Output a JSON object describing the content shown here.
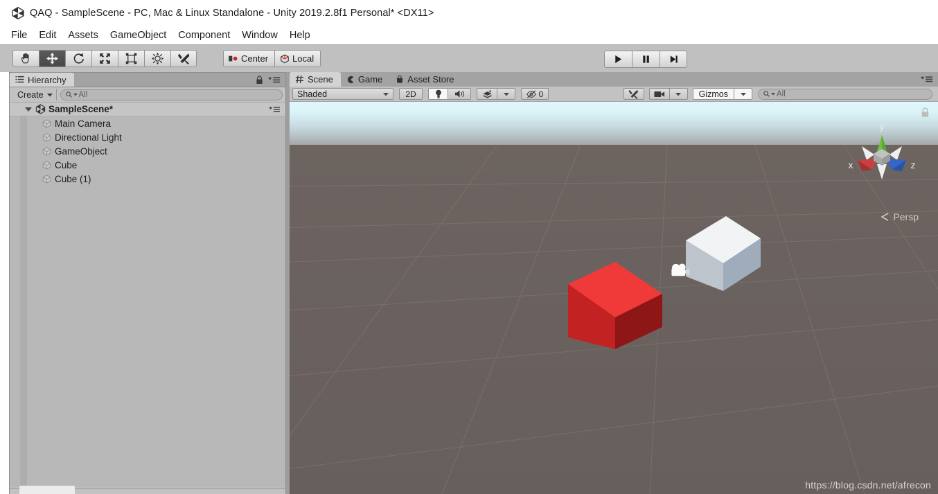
{
  "window": {
    "title": "QAQ - SampleScene - PC, Mac & Linux Standalone - Unity 2019.2.8f1 Personal* <DX11>",
    "logo_icon": "unity-logo-icon"
  },
  "menubar": {
    "items": [
      {
        "label": "File"
      },
      {
        "label": "Edit"
      },
      {
        "label": "Assets"
      },
      {
        "label": "GameObject"
      },
      {
        "label": "Component"
      },
      {
        "label": "Window"
      },
      {
        "label": "Help"
      }
    ]
  },
  "toolbar": {
    "tools": [
      {
        "name": "hand-tool",
        "icon": "hand-icon",
        "active": false
      },
      {
        "name": "move-tool",
        "icon": "move-arrows-icon",
        "active": true
      },
      {
        "name": "rotate-tool",
        "icon": "rotate-icon",
        "active": false
      },
      {
        "name": "scale-tool",
        "icon": "scale-icon",
        "active": false
      },
      {
        "name": "rect-tool",
        "icon": "rect-transform-icon",
        "active": false
      },
      {
        "name": "transform-tool",
        "icon": "transform-icon",
        "active": false
      },
      {
        "name": "custom-tool",
        "icon": "custom-editor-tool-icon",
        "active": false
      }
    ],
    "pivot_mode_label": "Center",
    "pivot_mode_icon": "pivot-center-icon",
    "pivot_rotation_label": "Local",
    "pivot_rotation_icon": "local-cube-icon",
    "play_label": "play-icon",
    "pause_label": "pause-icon",
    "step_label": "step-icon"
  },
  "hierarchy": {
    "tab_label": "Hierarchy",
    "tab_icon": "hierarchy-list-icon",
    "lock_icon": "lock-icon",
    "menu_icon": "panel-menu-icon",
    "create_label": "Create",
    "create_dropdown_icon": "chevron-down-icon",
    "search_placeholder": "All",
    "search_icon": "search-icon",
    "search_value": "",
    "scene_root": {
      "label": "SampleScene*",
      "icon": "unity-scene-icon",
      "expanded": true,
      "menu_icon": "scene-menu-icon"
    },
    "objects": [
      {
        "label": "Main Camera",
        "icon": "gameobject-cube-icon"
      },
      {
        "label": "Directional Light",
        "icon": "gameobject-cube-icon"
      },
      {
        "label": "GameObject",
        "icon": "gameobject-cube-icon"
      },
      {
        "label": "Cube",
        "icon": "gameobject-cube-icon"
      },
      {
        "label": "Cube (1)",
        "icon": "gameobject-cube-icon"
      }
    ]
  },
  "scene_panel": {
    "tabs": [
      {
        "label": "Scene",
        "icon": "scene-grid-icon",
        "active": true
      },
      {
        "label": "Game",
        "icon": "game-pacman-icon",
        "active": false
      },
      {
        "label": "Asset Store",
        "icon": "asset-store-bag-icon",
        "active": false
      }
    ],
    "menu_icon": "panel-menu-icon",
    "toolbar": {
      "draw_mode_label": "Shaded",
      "draw_mode_dropdown_icon": "chevron-down-icon",
      "view_2d_label": "2D",
      "lighting_icon": "lightbulb-icon",
      "lighting_on": true,
      "audio_icon": "speaker-icon",
      "effects_icon": "effects-icon",
      "effects_dropdown_icon": "chevron-down-icon",
      "hidden_objects_icon": "eye-off-icon",
      "hidden_objects_count": "0",
      "scene_tools_icon": "scene-tools-icon",
      "camera_icon": "camera-icon",
      "camera_dropdown_icon": "chevron-down-icon",
      "gizmos_label": "Gizmos",
      "gizmos_dropdown_icon": "chevron-down-icon",
      "search_placeholder": "All",
      "search_icon": "search-icon",
      "search_value": ""
    },
    "viewport": {
      "projection_label": "Persp",
      "projection_prefix_icon": "left-chevron-icon",
      "lock_icon": "gizmo-lock-icon",
      "axis_labels": {
        "x": "x",
        "y": "y",
        "z": "z"
      },
      "axis_colors": {
        "x": "#C94040",
        "y": "#6CC040",
        "z": "#3366C8",
        "neutral": "#E8E8E8",
        "center": "#B4B4B4"
      },
      "sky_top_color": "#DFF8FB",
      "sky_horizon_color": "#B0B8BC",
      "ground_color": "#6B625F",
      "grid_color": "#7D7571",
      "camera_gizmo_icon": "movie-camera-icon",
      "objects": [
        {
          "name": "red-cube",
          "top_color": "#F03A3A",
          "left_color": "#C32222",
          "right_color": "#8E1616"
        },
        {
          "name": "white-cube",
          "top_color": "#F8F9FA",
          "left_color": "#C8D2DC",
          "right_color": "#A5B5C7"
        }
      ],
      "watermark": "https://blog.csdn.net/afrecon"
    }
  }
}
